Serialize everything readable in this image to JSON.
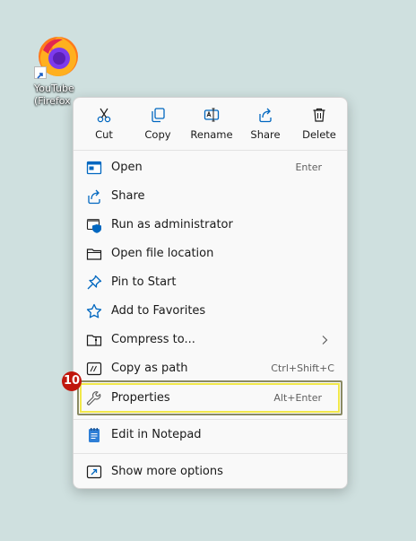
{
  "desktop_icon": {
    "label_line1": "YouTube",
    "label_line2": "(Firefox"
  },
  "toolbar": [
    {
      "name": "cut-button",
      "icon": "scissors-icon",
      "label": "Cut"
    },
    {
      "name": "copy-button",
      "icon": "copy-icon",
      "label": "Copy"
    },
    {
      "name": "rename-button",
      "icon": "rename-icon",
      "label": "Rename"
    },
    {
      "name": "share-button",
      "icon": "share-icon",
      "label": "Share"
    },
    {
      "name": "delete-button",
      "icon": "trash-icon",
      "label": "Delete"
    }
  ],
  "menu": {
    "open": {
      "label": "Open",
      "shortcut": "Enter"
    },
    "share": {
      "label": "Share"
    },
    "run_admin": {
      "label": "Run as administrator"
    },
    "open_location": {
      "label": "Open file location"
    },
    "pin_start": {
      "label": "Pin to Start"
    },
    "favorites": {
      "label": "Add to Favorites"
    },
    "compress": {
      "label": "Compress to..."
    },
    "copy_path": {
      "label": "Copy as path",
      "shortcut": "Ctrl+Shift+C"
    },
    "properties": {
      "label": "Properties",
      "shortcut": "Alt+Enter"
    },
    "notepad": {
      "label": "Edit in Notepad"
    },
    "more_options": {
      "label": "Show more options"
    }
  },
  "annotation": {
    "badge": "10"
  },
  "colors": {
    "accent": "#0067c0",
    "highlight": "#f1e84a",
    "badge": "#c0170d",
    "background": "#cfe0df"
  }
}
